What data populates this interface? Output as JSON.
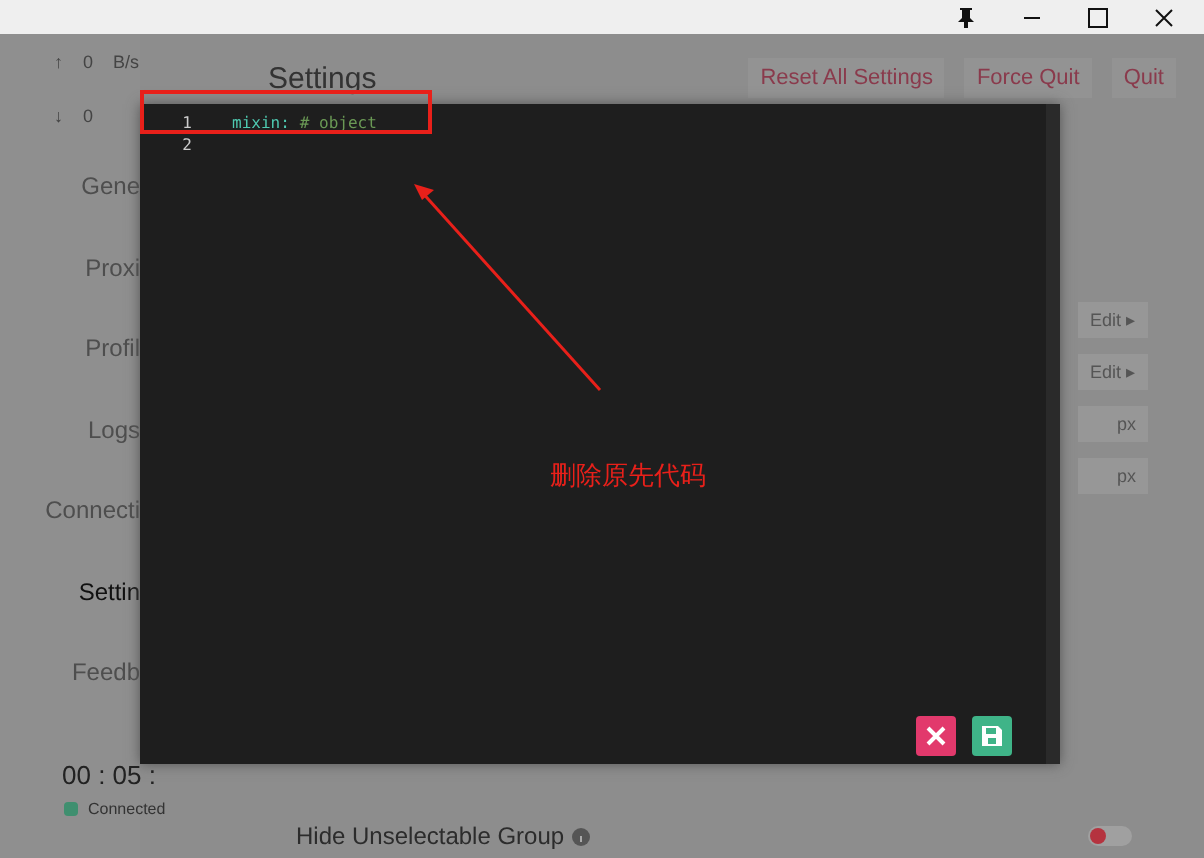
{
  "title_bar": {
    "buttons": [
      {
        "kind": "pin"
      },
      {
        "kind": "minimize"
      },
      {
        "kind": "maximize"
      },
      {
        "kind": "close"
      }
    ]
  },
  "traffic": [
    {
      "arrow": "↑",
      "value": "0",
      "unit": "B/s"
    },
    {
      "arrow": "↓",
      "value": "0"
    }
  ],
  "sidebar": {
    "items": [
      {
        "label": "Gene",
        "selected": false
      },
      {
        "label": "Proxi",
        "selected": false
      },
      {
        "label": "Profil",
        "selected": false
      },
      {
        "label": "Logs",
        "selected": false
      },
      {
        "label": "Connecti",
        "selected": false
      },
      {
        "label": "Settin",
        "selected": true
      },
      {
        "label": "Feedb",
        "selected": false
      }
    ],
    "timer": "00 : 05 :",
    "status": {
      "label": "Connected",
      "color": "#3f8f6f"
    }
  },
  "page": {
    "title": "Settings",
    "actions": [
      "Reset All Settings",
      "Force Quit",
      "Quit"
    ],
    "side_controls": [
      "Edit ▸",
      "Edit ▸",
      "px",
      "px"
    ],
    "settings": [
      {
        "label": "Hide Unselectable Group",
        "on": false
      }
    ]
  },
  "editor": {
    "lines": [
      {
        "number": "1",
        "key": "mixin:",
        "comment": "# object"
      },
      {
        "number": "2"
      }
    ]
  },
  "annotation": {
    "note": "删除原先代码"
  }
}
